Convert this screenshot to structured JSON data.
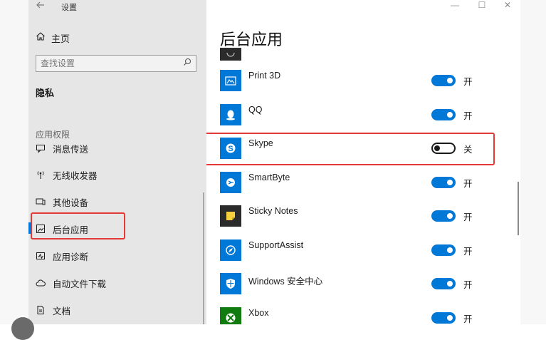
{
  "window": {
    "title": "设置",
    "controls": {
      "minimize": "—",
      "maximize": "☐",
      "close": "✕"
    }
  },
  "sidebar": {
    "back_icon": "back-arrow-icon",
    "home_label": "主页",
    "search": {
      "placeholder": "查找设置",
      "value": ""
    },
    "section_title": "隐私",
    "group_title": "应用权限",
    "items": [
      {
        "label": "消息传送",
        "icon": "message-icon"
      },
      {
        "label": "无线收发器",
        "icon": "antenna-icon"
      },
      {
        "label": "其他设备",
        "icon": "devices-icon"
      },
      {
        "label": "后台应用",
        "icon": "background-apps-icon",
        "active": true
      },
      {
        "label": "应用诊断",
        "icon": "diagnostics-icon"
      },
      {
        "label": "自动文件下载",
        "icon": "cloud-icon"
      },
      {
        "label": "文档",
        "icon": "document-icon"
      }
    ]
  },
  "main": {
    "title": "后台应用",
    "apps": [
      {
        "name": "Print 3D",
        "state": "开",
        "on": true,
        "icon_color": "#0078d7",
        "icon": "print3d-icon"
      },
      {
        "name": "QQ",
        "state": "开",
        "on": true,
        "icon_color": "#0078d7",
        "icon": "qq-penguin-icon"
      },
      {
        "name": "Skype",
        "state": "关",
        "on": false,
        "icon_color": "#0078d7",
        "icon": "skype-icon"
      },
      {
        "name": "SmartByte",
        "state": "开",
        "on": true,
        "icon_color": "#0078d7",
        "icon": "smartbyte-icon"
      },
      {
        "name": "Sticky Notes",
        "state": "开",
        "on": true,
        "icon_color": "#2b2b2b",
        "icon": "sticky-notes-icon"
      },
      {
        "name": "SupportAssist",
        "state": "开",
        "on": true,
        "icon_color": "#0078d7",
        "icon": "support-assist-icon"
      },
      {
        "name": "Windows 安全中心",
        "state": "开",
        "on": true,
        "icon_color": "#0078d7",
        "icon": "shield-icon"
      },
      {
        "name": "Xbox",
        "state": "开",
        "on": true,
        "icon_color": "#107c10",
        "icon": "xbox-icon"
      }
    ]
  },
  "colors": {
    "accent": "#0078d7",
    "highlight_border": "#e53935",
    "sidebar_bg": "#e6e6e6"
  }
}
